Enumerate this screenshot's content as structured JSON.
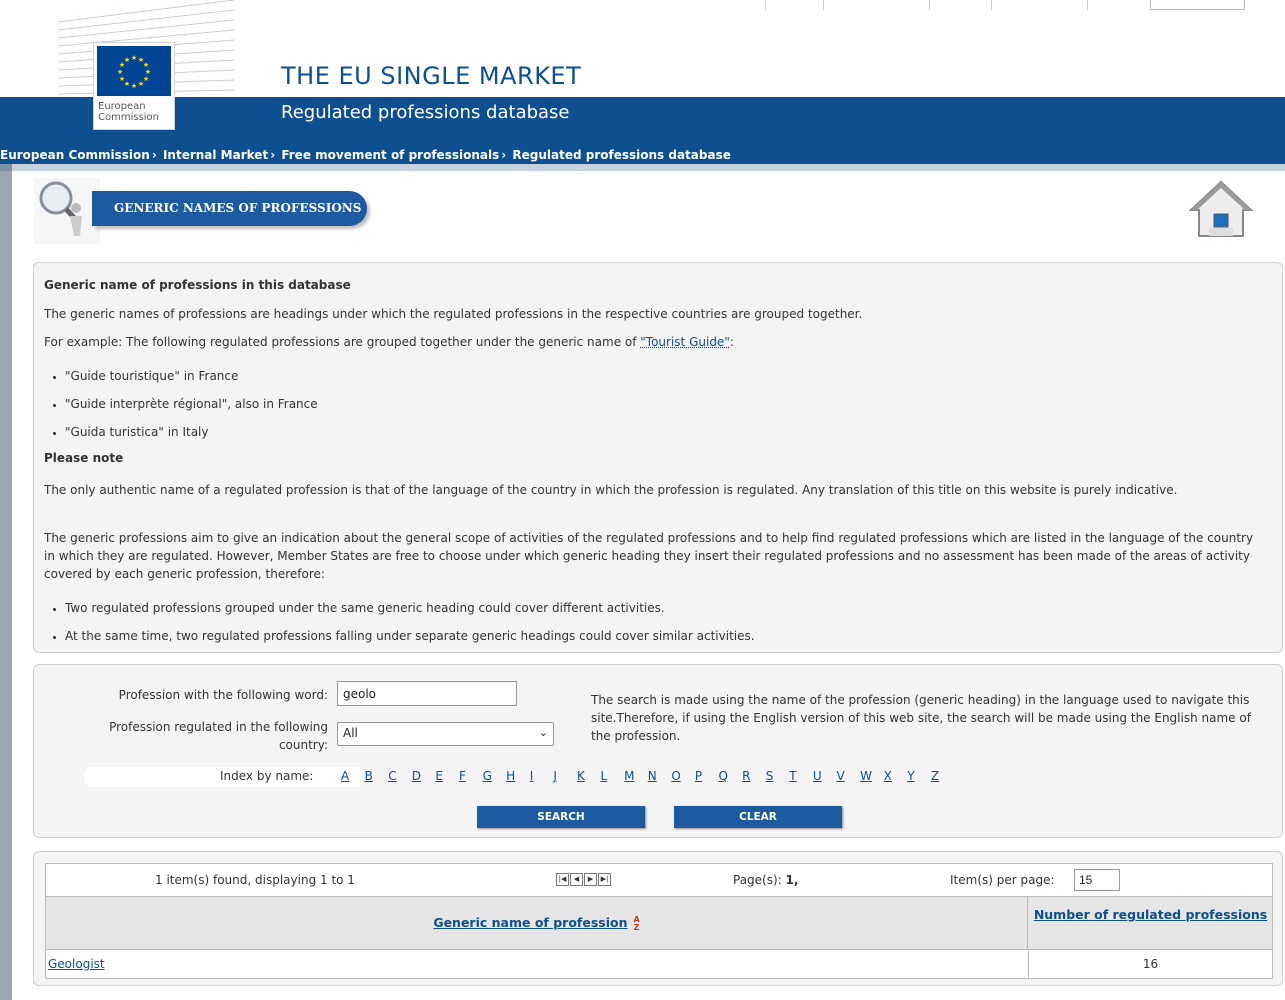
{
  "header": {
    "title": "THE EU SINGLE MARKET",
    "subtitle": "Regulated professions database",
    "logo_line1": "European",
    "logo_line2": "Commission"
  },
  "breadcrumb": [
    "European Commission",
    "Internal Market",
    "Free movement of professionals",
    "Regulated professions database"
  ],
  "section": {
    "heading": "GENERIC NAMES OF PROFESSIONS"
  },
  "info": {
    "title": "Generic name of professions in this database",
    "p1": "The generic names of professions are headings under which the regulated professions in the respective countries are grouped together.",
    "p2_prefix": "For example: The following regulated professions are grouped together under the generic name of ",
    "p2_link": "\"Tourist Guide\"",
    "p2_suffix": ":",
    "examples": [
      "\"Guide touristique\" in France",
      "\"Guide interprète régional\", also in France",
      "\"Guida turistica\" in Italy"
    ],
    "note_title": "Please note",
    "p3": "The only authentic name of a regulated profession is that of the language of the country in which the profession is regulated. Any translation of this title on this website is purely indicative.",
    "p4": "The generic professions aim to give an indication about the general scope of activities of the regulated professions and to help find regulated professions which are listed in the language of the country in which they are regulated. However, Member States are free to choose under which generic heading they insert their regulated professions and no assessment has been made of the areas of activity covered by each generic profession, therefore:",
    "bullets": [
      "Two regulated professions grouped under the same generic heading could cover different activities.",
      "At the same time, two regulated professions falling under separate generic headings could cover similar activities."
    ]
  },
  "search": {
    "word_label": "Profession with the following word:",
    "word_value": "geolo",
    "country_label": "Profession regulated in the following country:",
    "country_value": "All",
    "help": "The search is made using the name of the profession (generic heading) in the language used to navigate this site.Therefore, if using the English version of this web site, the search will be made using the English name of the profession.",
    "index_label": "Index by name:",
    "letters": [
      "A",
      "B",
      "C",
      "D",
      "E",
      "F",
      "G",
      "H",
      "I",
      "J",
      "K",
      "L",
      "M",
      "N",
      "O",
      "P",
      "Q",
      "R",
      "S",
      "T",
      "U",
      "V",
      "W",
      "X",
      "Y",
      "Z"
    ],
    "search_button": "SEARCH",
    "clear_button": "CLEAR"
  },
  "results": {
    "found_text": "1 item(s) found, displaying 1 to 1",
    "pager_icons": [
      "first-page-icon",
      "prev-page-icon",
      "next-page-icon",
      "last-page-icon"
    ],
    "pages_label": "Page(s):",
    "pages_value": "1,",
    "per_page_label": "Item(s) per page:",
    "per_page_value": "15",
    "col_name": "Generic name of profession",
    "col_count": "Number of regulated professions",
    "rows": [
      {
        "name": "Geologist",
        "count": "16"
      }
    ]
  },
  "colors": {
    "brand_blue": "#0e4f8f",
    "button_blue": "#1d5aa0",
    "panel_bg": "#f4f4f4"
  }
}
